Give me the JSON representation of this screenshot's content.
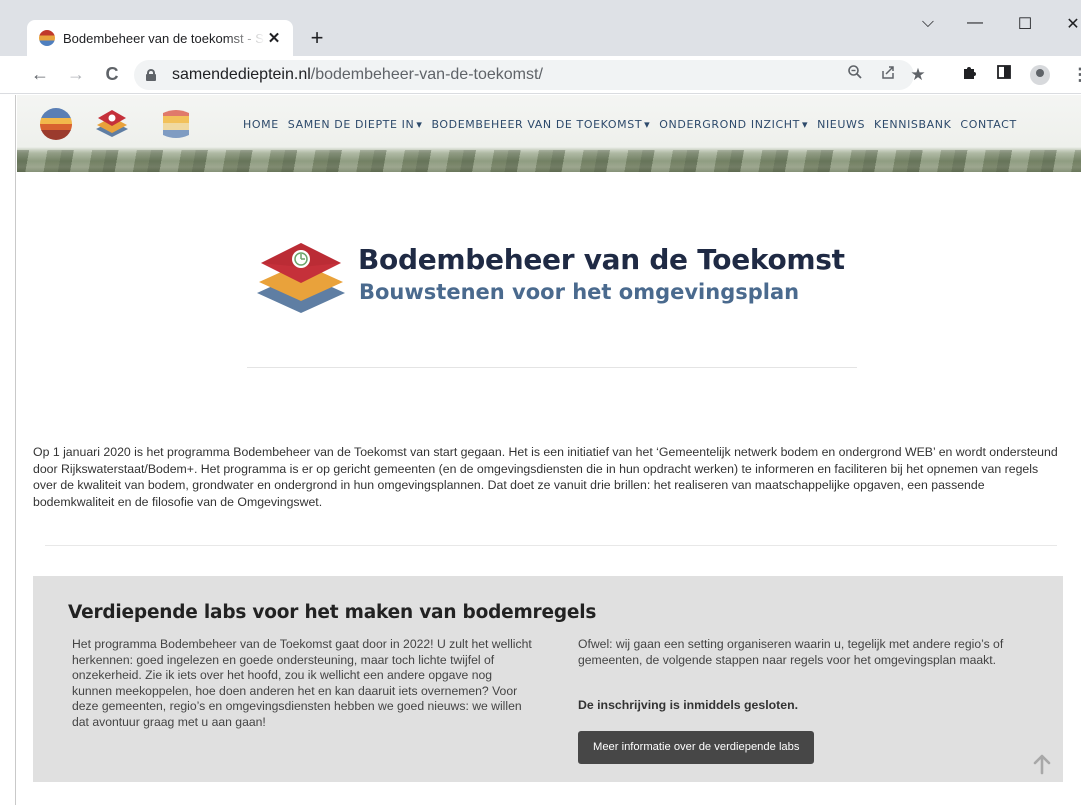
{
  "browser": {
    "tab_title": "Bodembeheer van de toekomst - Sa",
    "tab_close": "✕",
    "new_tab": "+",
    "window_controls": {
      "chevron": "⌵",
      "minimize": "—",
      "maximize": "☐",
      "close": "✕"
    },
    "nav": {
      "back": "←",
      "forward": "→",
      "reload": "C"
    },
    "url_host": "samendedieptein.nl",
    "url_path": "/bodembeheer-van-de-toekomst/",
    "toolbar_icons": {
      "zoom": "zoom-icon",
      "share": "share-icon",
      "bookmark": "★",
      "extensions": "puzzle-icon",
      "sidepanel": "sidepanel-icon",
      "menu": "⋮"
    }
  },
  "site": {
    "nav": [
      {
        "label": "HOME",
        "dropdown": false
      },
      {
        "label": "SAMEN DE DIEPTE IN",
        "dropdown": true
      },
      {
        "label": "BODEMBEHEER VAN DE TOEKOMST",
        "dropdown": true
      },
      {
        "label": "ONDERGROND INZICHT",
        "dropdown": true
      },
      {
        "label": "NIEUWS",
        "dropdown": false
      },
      {
        "label": "KENNISBANK",
        "dropdown": false
      },
      {
        "label": "CONTACT",
        "dropdown": false
      }
    ],
    "caret": "▾"
  },
  "hero": {
    "title": "Bodembeheer van de Toekomst",
    "subtitle": "Bouwstenen voor het omgevingsplan"
  },
  "intro": {
    "text": "Op 1 januari 2020 is het programma Bodembeheer van de Toekomst van start gegaan. Het is een initiatief van het ‘Gemeentelijk netwerk bodem en ondergrond WEB’ en wordt ondersteund door Rijkswaterstaat/Bodem+. Het programma is er op gericht gemeenten (en de omgevingsdiensten die in hun opdracht werken) te informeren en faciliteren bij het opnemen van regels over de kwaliteit van bodem, grondwater en ondergrond in hun omgevingsplannen. Dat doet ze vanuit drie brillen: het realiseren van maatschappelijke opgaven, een passende bodemkwaliteit en de filosofie van de Omgevingswet."
  },
  "labs": {
    "title": "Verdiepende labs voor het maken van bodemregels",
    "left_text": "Het programma Bodembeheer van de Toekomst gaat door in 2022! U zult het wellicht herkennen: goed ingelezen en goede ondersteuning, maar toch lichte twijfel of onzekerheid. Zie ik iets over het hoofd, zou ik wellicht een andere opgave nog kunnen meekoppelen, hoe doen anderen het en kan daaruit iets overnemen? Voor deze gemeenten, regio’s en omgevingsdiensten hebben we goed nieuws: we willen dat avontuur graag met u aan gaan!",
    "right_text": "Ofwel: wij gaan een setting organiseren waarin u, tegelijk met andere regio’s of gemeenten, de volgende stappen naar regels voor het omgevingsplan maakt.",
    "closed_notice": "De inschrijving is inmiddels gesloten.",
    "button_label": "Meer informatie over de verdiepende labs"
  },
  "colors": {
    "nav_text": "#2d4a6b",
    "hero_title": "#1f2a44",
    "hero_subtitle": "#4a6a8e",
    "labs_bg": "#e0e0e0",
    "button_bg": "#474747",
    "logo_red": "#c5303a",
    "logo_orange": "#e9a23b",
    "logo_blue": "#5f7ea3"
  }
}
